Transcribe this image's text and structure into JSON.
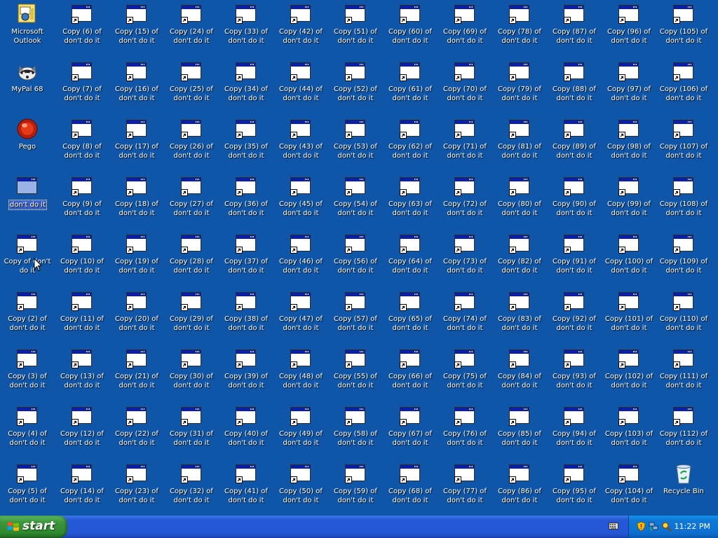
{
  "desktop": {
    "icons": [
      {
        "label": "Microsoft\nOutlook",
        "type": "outlook"
      },
      {
        "label": "Copy (6) of\ndon't do it"
      },
      {
        "label": "Copy (15) of\ndon't do it"
      },
      {
        "label": "Copy (24) of\ndon't do it"
      },
      {
        "label": "Copy (33) of\ndon't do it"
      },
      {
        "label": "Copy (42) of\ndon't do it"
      },
      {
        "label": "Copy (51) of\ndon't do it"
      },
      {
        "label": "Copy (60) of\ndon't do it"
      },
      {
        "label": "Copy (69) of\ndon't do it"
      },
      {
        "label": "Copy (78) of\ndon't do it"
      },
      {
        "label": "Copy (87) of\ndon't do it"
      },
      {
        "label": "Copy (96) of\ndon't do it"
      },
      {
        "label": "Copy (105) of\ndon't do it"
      },
      {
        "label": "MyPal 68",
        "type": "mypal"
      },
      {
        "label": "Copy (7) of\ndon't do it"
      },
      {
        "label": "Copy (16) of\ndon't do it"
      },
      {
        "label": "Copy (25) of\ndon't do it"
      },
      {
        "label": "Copy (34) of\ndon't do it"
      },
      {
        "label": "Copy (44) of\ndon't do it"
      },
      {
        "label": "Copy (52) of\ndon't do it"
      },
      {
        "label": "Copy (61) of\ndon't do it"
      },
      {
        "label": "Copy (70) of\ndon't do it"
      },
      {
        "label": "Copy (79) of\ndon't do it"
      },
      {
        "label": "Copy (88) of\ndon't do it"
      },
      {
        "label": "Copy (97) of\ndon't do it"
      },
      {
        "label": "Copy (106) of\ndon't do it"
      },
      {
        "label": "Pego",
        "type": "pego"
      },
      {
        "label": "Copy (8) of\ndon't do it"
      },
      {
        "label": "Copy (17) of\ndon't do it"
      },
      {
        "label": "Copy (26) of\ndon't do it"
      },
      {
        "label": "Copy (35) of\ndon't do it"
      },
      {
        "label": "Copy (43) of\ndon't do it"
      },
      {
        "label": "Copy (53) of\ndon't do it"
      },
      {
        "label": "Copy (62) of\ndon't do it"
      },
      {
        "label": "Copy (71) of\ndon't do it"
      },
      {
        "label": "Copy (81) of\ndon't do it"
      },
      {
        "label": "Copy (89) of\ndon't do it"
      },
      {
        "label": "Copy (98) of\ndon't do it"
      },
      {
        "label": "Copy (107) of\ndon't do it"
      },
      {
        "label": "don't do it",
        "type": "selected"
      },
      {
        "label": "Copy (9) of\ndon't do it"
      },
      {
        "label": "Copy (18) of\ndon't do it"
      },
      {
        "label": "Copy (27) of\ndon't do it"
      },
      {
        "label": "Copy (36) of\ndon't do it"
      },
      {
        "label": "Copy (45) of\ndon't do it"
      },
      {
        "label": "Copy (54) of\ndon't do it"
      },
      {
        "label": "Copy (63) of\ndon't do it"
      },
      {
        "label": "Copy (72) of\ndon't do it"
      },
      {
        "label": "Copy (80) of\ndon't do it"
      },
      {
        "label": "Copy (90) of\ndon't do it"
      },
      {
        "label": "Copy (99) of\ndon't do it"
      },
      {
        "label": "Copy (108) of\ndon't do it"
      },
      {
        "label": "Copy of don't\ndo it"
      },
      {
        "label": "Copy (10) of\ndon't do it"
      },
      {
        "label": "Copy (19) of\ndon't do it"
      },
      {
        "label": "Copy (28) of\ndon't do it"
      },
      {
        "label": "Copy (37) of\ndon't do it"
      },
      {
        "label": "Copy (46) of\ndon't do it"
      },
      {
        "label": "Copy (56) of\ndon't do it"
      },
      {
        "label": "Copy (64) of\ndon't do it"
      },
      {
        "label": "Copy (73) of\ndon't do it"
      },
      {
        "label": "Copy (82) of\ndon't do it"
      },
      {
        "label": "Copy (91) of\ndon't do it"
      },
      {
        "label": "Copy (100) of\ndon't do it"
      },
      {
        "label": "Copy (109) of\ndon't do it"
      },
      {
        "label": "Copy (2) of\ndon't do it"
      },
      {
        "label": "Copy (11) of\ndon't do it"
      },
      {
        "label": "Copy (20) of\ndon't do it"
      },
      {
        "label": "Copy (29) of\ndon't do it"
      },
      {
        "label": "Copy (38) of\ndon't do it"
      },
      {
        "label": "Copy (47) of\ndon't do it"
      },
      {
        "label": "Copy (57) of\ndon't do it"
      },
      {
        "label": "Copy (65) of\ndon't do it"
      },
      {
        "label": "Copy (74) of\ndon't do it"
      },
      {
        "label": "Copy (83) of\ndon't do it"
      },
      {
        "label": "Copy (92) of\ndon't do it"
      },
      {
        "label": "Copy (101) of\ndon't do it"
      },
      {
        "label": "Copy (110) of\ndon't do it"
      },
      {
        "label": "Copy (3) of\ndon't do it"
      },
      {
        "label": "Copy (13) of\ndon't do it"
      },
      {
        "label": "Copy (21) of\ndon't do it"
      },
      {
        "label": "Copy (30) of\ndon't do it"
      },
      {
        "label": "Copy (39) of\ndon't do it"
      },
      {
        "label": "Copy (48) of\ndon't do it"
      },
      {
        "label": "Copy (55) of\ndon't do it"
      },
      {
        "label": "Copy (66) of\ndon't do it"
      },
      {
        "label": "Copy (75) of\ndon't do it"
      },
      {
        "label": "Copy (84) of\ndon't do it"
      },
      {
        "label": "Copy (93) of\ndon't do it"
      },
      {
        "label": "Copy (102) of\ndon't do it"
      },
      {
        "label": "Copy (111) of\ndon't do it"
      },
      {
        "label": "Copy (4) of\ndon't do it"
      },
      {
        "label": "Copy (12) of\ndon't do it"
      },
      {
        "label": "Copy (22) of\ndon't do it"
      },
      {
        "label": "Copy (31) of\ndon't do it"
      },
      {
        "label": "Copy (40) of\ndon't do it"
      },
      {
        "label": "Copy (49) of\ndon't do it"
      },
      {
        "label": "Copy (58) of\ndon't do it"
      },
      {
        "label": "Copy (67) of\ndon't do it"
      },
      {
        "label": "Copy (76) of\ndon't do it"
      },
      {
        "label": "Copy (85) of\ndon't do it"
      },
      {
        "label": "Copy (94) of\ndon't do it"
      },
      {
        "label": "Copy (103) of\ndon't do it"
      },
      {
        "label": "Copy (112) of\ndon't do it"
      },
      {
        "label": "Copy (5) of\ndon't do it"
      },
      {
        "label": "Copy (14) of\ndon't do it"
      },
      {
        "label": "Copy (23) of\ndon't do it"
      },
      {
        "label": "Copy (32) of\ndon't do it"
      },
      {
        "label": "Copy (41) of\ndon't do it"
      },
      {
        "label": "Copy (50) of\ndon't do it"
      },
      {
        "label": "Copy (59) of\ndon't do it"
      },
      {
        "label": "Copy (68) of\ndon't do it"
      },
      {
        "label": "Copy (77) of\ndon't do it"
      },
      {
        "label": "Copy (86) of\ndon't do it"
      },
      {
        "label": "Copy (95) of\ndon't do it"
      },
      {
        "label": "Copy (104) of\ndon't do it"
      },
      {
        "label": "Recycle Bin",
        "type": "recycle"
      }
    ]
  },
  "taskbar": {
    "start_label": "start",
    "clock": "11:22 PM"
  },
  "colors": {
    "desktop": "#0f56a8",
    "taskbar": "#2456d4",
    "start": "#3c963c",
    "tray": "#0f79d8"
  }
}
